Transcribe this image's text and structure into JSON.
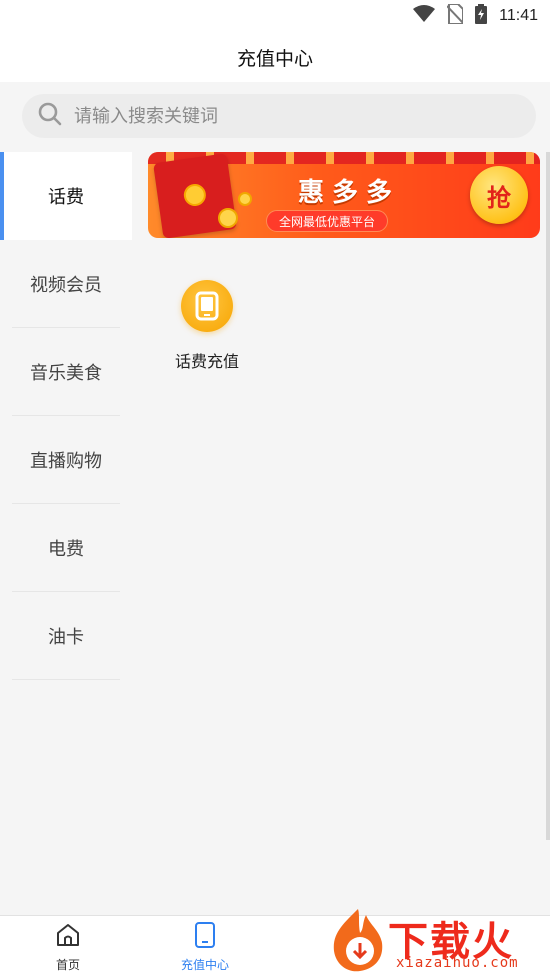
{
  "status_bar": {
    "time": "11:41",
    "icons": [
      "wifi-icon",
      "no-sim-icon",
      "battery-charging-icon"
    ]
  },
  "header": {
    "title": "充值中心"
  },
  "search": {
    "placeholder": "请输入搜索关键词",
    "icon": "search-icon"
  },
  "sidebar": {
    "items": [
      {
        "label": "话费",
        "active": true
      },
      {
        "label": "视频会员",
        "active": false
      },
      {
        "label": "音乐美食",
        "active": false
      },
      {
        "label": "直播购物",
        "active": false
      },
      {
        "label": "电费",
        "active": false
      },
      {
        "label": "油卡",
        "active": false
      }
    ]
  },
  "banner": {
    "headline": "惠多多",
    "subline": "全网最低优惠平台",
    "grab_label": "抢",
    "colors": {
      "primary": "#ff5a1a",
      "accent": "#ffc21a"
    }
  },
  "features": [
    {
      "label": "话费充值",
      "icon": "phone-icon",
      "color": "#f7a400"
    }
  ],
  "bottom_nav": {
    "items": [
      {
        "label": "首页",
        "icon": "home-icon",
        "active": false
      },
      {
        "label": "充值中心",
        "icon": "tablet-icon",
        "active": true
      }
    ],
    "active_color": "#2d7ff0"
  },
  "watermark": {
    "brand": "下载火",
    "domain": "xiazaihuo.com"
  }
}
